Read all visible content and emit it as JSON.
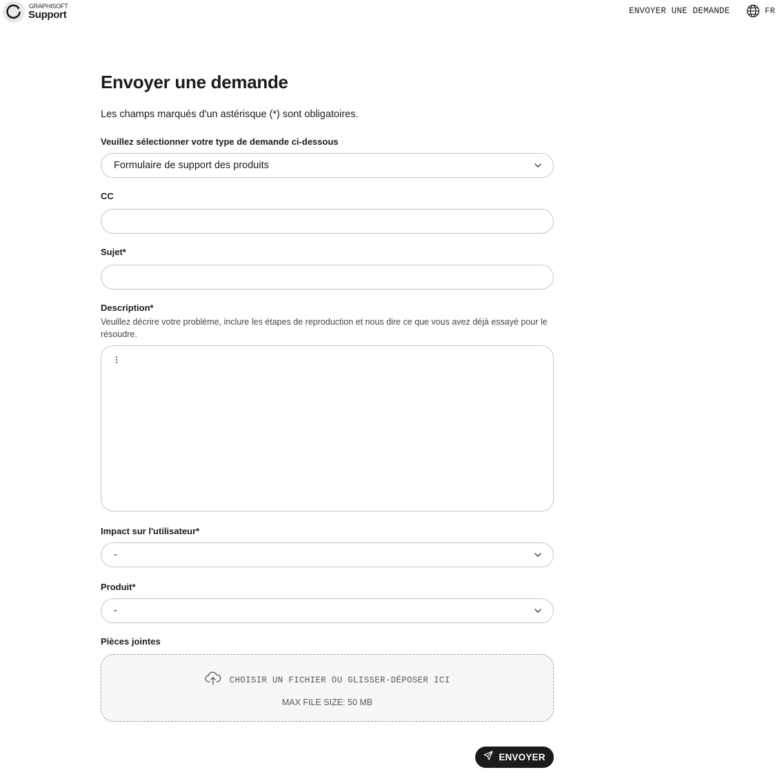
{
  "header": {
    "logo_small": "GRAPHISOFT",
    "logo_big": "Support",
    "nav_link": "ENVOYER UNE DEMANDE",
    "language": "FR"
  },
  "form": {
    "title": "Envoyer une demande",
    "intro": "Les champs marqués d'un astérisque (*) sont obligatoires.",
    "request_type": {
      "label": "Veuillez sélectionner votre type de demande ci-dessous",
      "value": "Formulaire de support des produits"
    },
    "cc": {
      "label": "CC",
      "value": ""
    },
    "subject": {
      "label": "Sujet*",
      "value": ""
    },
    "description": {
      "label": "Description*",
      "hint": "Veuillez décrire votre problème, inclure les étapes de reproduction et nous dire ce que vous avez déjà essayé pour le résoudre.",
      "value": ""
    },
    "impact": {
      "label": "Impact sur l'utilisateur*",
      "value": "-"
    },
    "product": {
      "label": "Produit*",
      "value": "-"
    },
    "attachments": {
      "label": "Pièces jointes",
      "dropzone_text": "CHOISIR UN FICHIER OU GLISSER-DÉPOSER ICI",
      "max_size": "MAX FILE SIZE: 50 MB"
    },
    "submit_label": "ENVOYER"
  },
  "icons": {
    "logo": "graphisoft-logo-icon",
    "language": "globe-icon",
    "select": "chevron-down-icon",
    "toolbar": "more-vertical-icon",
    "upload": "cloud-upload-icon",
    "submit": "send-icon"
  }
}
